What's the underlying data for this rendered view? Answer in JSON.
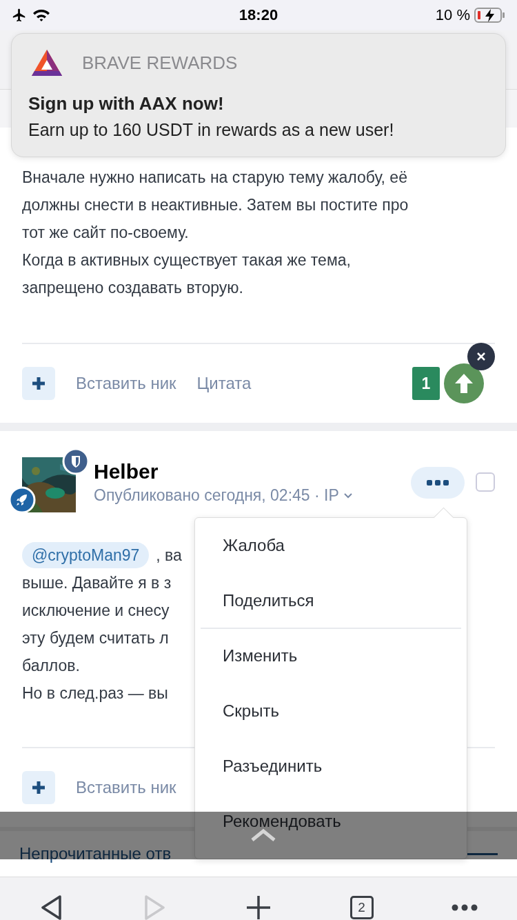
{
  "status_bar": {
    "time": "18:20",
    "battery": "10 %"
  },
  "notification": {
    "app": "BRAVE REWARDS",
    "title": "Sign up with AAX now!",
    "body": "Earn up to 160 USDT in rewards as a new user!"
  },
  "first_post": {
    "paragraphs": [
      [
        "Вначале нужно написать на старую тему жалобу, её",
        "должны снести в неактивные. Затем вы постите про",
        "тот же сайт по-своему."
      ],
      [
        "Когда в активных существует такая же тема,",
        "запрещено создавать вторую."
      ]
    ],
    "actions": [
      "Вставить ник",
      "Цитата"
    ],
    "votes": "1"
  },
  "second_post": {
    "author": "Helber",
    "meta": "Опубликовано сегодня, 02:45 · IP",
    "checked": false,
    "mention": "@cryptoMan97",
    "lines": [
      ", ва",
      "выше. Давайте я в з",
      "исключение и снесу",
      "эту будем считать л",
      "баллов.",
      "Но в след.раз — вы"
    ],
    "actions": [
      "Вставить ник"
    ]
  },
  "menu": {
    "groups": [
      [
        "Жалоба",
        "Поделиться"
      ],
      [
        "Изменить",
        "Скрыть",
        "Разъединить",
        "Рекомендовать"
      ]
    ]
  },
  "section_title": "Непрочитанные отв",
  "toolbar": {
    "forward_disabled": true,
    "tabs_count": "2"
  }
}
